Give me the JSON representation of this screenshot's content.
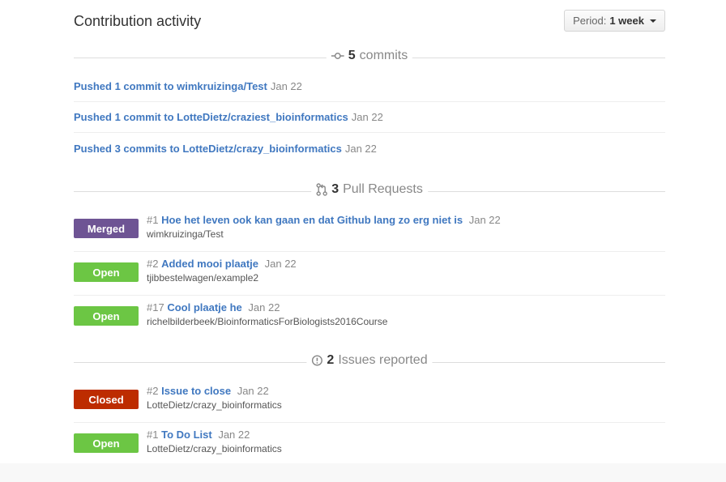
{
  "header": {
    "title": "Contribution activity",
    "period_label": "Period:",
    "period_value": "1 week"
  },
  "commits_section": {
    "count": "5",
    "label": "commits",
    "items": [
      {
        "text": "Pushed 1 commit to wimkruizinga/Test",
        "date": "Jan 22"
      },
      {
        "text": "Pushed 1 commit to LotteDietz/craziest_bioinformatics",
        "date": "Jan 22"
      },
      {
        "text": "Pushed 3 commits to LotteDietz/crazy_bioinformatics",
        "date": "Jan 22"
      }
    ]
  },
  "pr_section": {
    "count": "3",
    "label": "Pull Requests",
    "items": [
      {
        "state": "Merged",
        "number": "#1",
        "title": "Hoe het leven ook kan gaan en dat Github lang zo erg niet is",
        "date": "Jan 22",
        "repo": "wimkruizinga/Test"
      },
      {
        "state": "Open",
        "number": "#2",
        "title": "Added mooi plaatje",
        "date": "Jan 22",
        "repo": "tjibbestelwagen/example2"
      },
      {
        "state": "Open",
        "number": "#17",
        "title": "Cool plaatje he",
        "date": "Jan 22",
        "repo": "richelbilderbeek/BioinformaticsForBiologists2016Course"
      }
    ]
  },
  "issues_section": {
    "count": "2",
    "label": "Issues reported",
    "items": [
      {
        "state": "Closed",
        "number": "#2",
        "title": "Issue to close",
        "date": "Jan 22",
        "repo": "LotteDietz/crazy_bioinformatics"
      },
      {
        "state": "Open",
        "number": "#1",
        "title": "To Do List",
        "date": "Jan 22",
        "repo": "LotteDietz/crazy_bioinformatics"
      }
    ]
  },
  "colors": {
    "link": "#4078c0",
    "merged": "#6e5494",
    "open": "#6cc644",
    "closed": "#bd2c00"
  },
  "icons": {
    "commits": "git-commit-icon",
    "pull_requests": "git-pull-request-icon",
    "issues": "issue-opened-icon"
  }
}
